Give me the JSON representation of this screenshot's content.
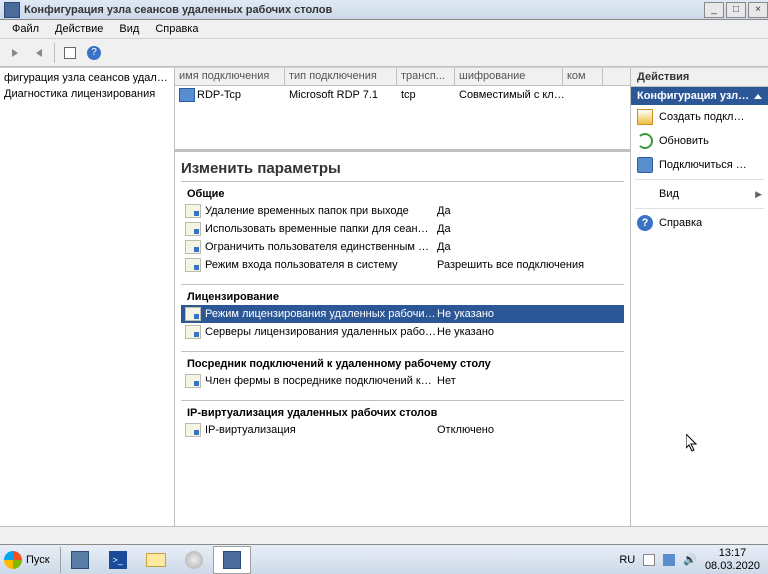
{
  "window": {
    "title": "Конфигурация узла сеансов удаленных рабочих столов"
  },
  "menu": {
    "file": "Файл",
    "action": "Действие",
    "view": "Вид",
    "help": "Справка"
  },
  "nav": {
    "item1": "фигурация узла сеансов удаленных",
    "item2": "Диагностика лицензирования"
  },
  "listheader": {
    "c1": "имя подключения",
    "c2": "тип подключения",
    "c3": "трансп...",
    "c4": "шифрование",
    "c5": "ком"
  },
  "listrow": {
    "name": "RDP-Tcp",
    "type": "Microsoft RDP 7.1",
    "transport": "tcp",
    "enc": "Совместимый с кл…"
  },
  "params": {
    "title": "Изменить параметры",
    "sec1": "Общие",
    "r1l": "Удаление временных папок при выходе",
    "r1v": "Да",
    "r2l": "Использовать временные папки для сеан…",
    "r2v": "Да",
    "r3l": "Ограничить пользователя единственным …",
    "r3v": "Да",
    "r4l": "Режим входа пользователя в систему",
    "r4v": "Разрешить все подключения",
    "sec2": "Лицензирование",
    "r5l": "Режим лицензирования удаленных рабочи…",
    "r5v": "Не указано",
    "r6l": "Серверы лицензирования удаленных рабо…",
    "r6v": "Не указано",
    "sec3": "Посредник подключений к удаленному рабочему столу",
    "r7l": "Член фермы в посреднике подключений к…",
    "r7v": "Нет",
    "sec4": "IP-виртуализация удаленных рабочих столов",
    "r8l": "IP-виртуализация",
    "r8v": "Отключено"
  },
  "actions": {
    "title": "Действия",
    "sub": "Конфигурация узл…",
    "create": "Создать подкл…",
    "refresh": "Обновить",
    "connect": "Подключиться …",
    "view": "Вид",
    "help": "Справка",
    "helpglyph": "?"
  },
  "taskbar": {
    "start": "Пуск",
    "lang": "RU",
    "time": "13:17",
    "date": "08.03.2020"
  }
}
